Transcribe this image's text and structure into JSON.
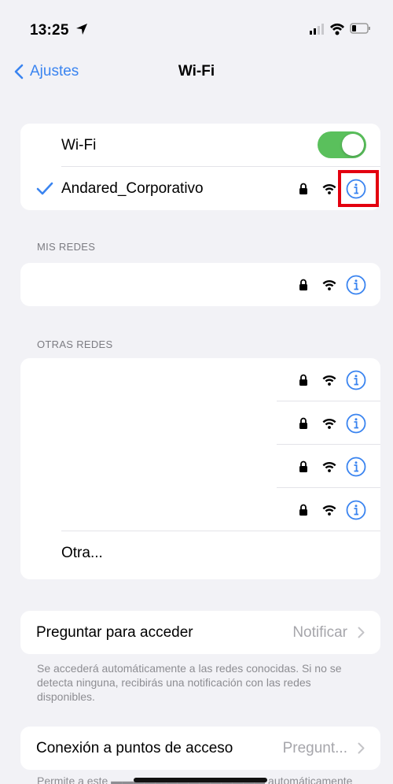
{
  "status_bar": {
    "time": "13:25"
  },
  "nav": {
    "back_label": "Ajustes",
    "title": "Wi-Fi"
  },
  "wifi_group": {
    "toggle_label": "Wi-Fi",
    "toggle_on": true,
    "connected_network": "Andared_Corporativo"
  },
  "mis_redes": {
    "header": "MIS REDES",
    "networks": [
      ""
    ]
  },
  "otras_redes": {
    "header": "OTRAS REDES",
    "networks": [
      "",
      "",
      "",
      ""
    ],
    "other_label": "Otra..."
  },
  "ask_join": {
    "label": "Preguntar para acceder",
    "value": "Notificar",
    "footnote": "Se accederá automáticamente a las redes conocidas. Si no se detecta ninguna, recibirás una notificación con las redes disponibles."
  },
  "hotspot": {
    "label": "Conexión a puntos de acceso",
    "value": "Pregunt...",
    "footnote": "Permite a este ▬▬▬▬▬▬▬▬▬▬▬▬▬▬ automáticamente"
  },
  "colors": {
    "accent": "#3a84f0",
    "toggle_on": "#5ac05c",
    "background": "#f2f2f6",
    "highlight": "#e3000f"
  }
}
